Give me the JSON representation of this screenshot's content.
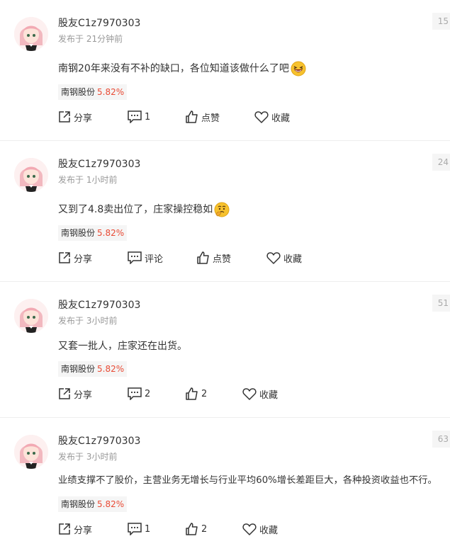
{
  "posts": [
    {
      "username": "股友C1z7970303",
      "time": "发布于 21分钟前",
      "floor": "15",
      "content": "南钢20年来没有不补的缺口，各位知道该做什么了吧",
      "emoji": "laughing-emoji",
      "stock_name": "南钢股份",
      "stock_change": "5.82%",
      "share_label": "分享",
      "comment_label": "1",
      "like_label": "点赞",
      "collect_label": "收藏"
    },
    {
      "username": "股友C1z7970303",
      "time": "发布于 1小时前",
      "floor": "24",
      "content": "又到了4.8卖出位了，庄家操控稳如",
      "emoji": "thinking-emoji",
      "stock_name": "南钢股份",
      "stock_change": "5.82%",
      "share_label": "分享",
      "comment_label": "评论",
      "like_label": "点赞",
      "collect_label": "收藏"
    },
    {
      "username": "股友C1z7970303",
      "time": "发布于 3小时前",
      "floor": "51",
      "content": "又套一批人，庄家还在出货。",
      "stock_name": "南钢股份",
      "stock_change": "5.82%",
      "share_label": "分享",
      "comment_label": "2",
      "like_label": "2",
      "collect_label": "收藏"
    },
    {
      "username": "股友C1z7970303",
      "time": "发布于 3小时前",
      "floor": "63",
      "content": "业绩支撑不了股价，主营业务无增长与行业平均60%增长差距巨大，各种投资收益也不行。",
      "stock_name": "南钢股份",
      "stock_change": "5.82%",
      "share_label": "分享",
      "comment_label": "1",
      "like_label": "2",
      "collect_label": "收藏"
    }
  ],
  "colors": {
    "stock_change": "#e94b35",
    "meta_text": "#999999",
    "divider": "#eeeeee",
    "tag_bg": "#f5f5f5"
  }
}
